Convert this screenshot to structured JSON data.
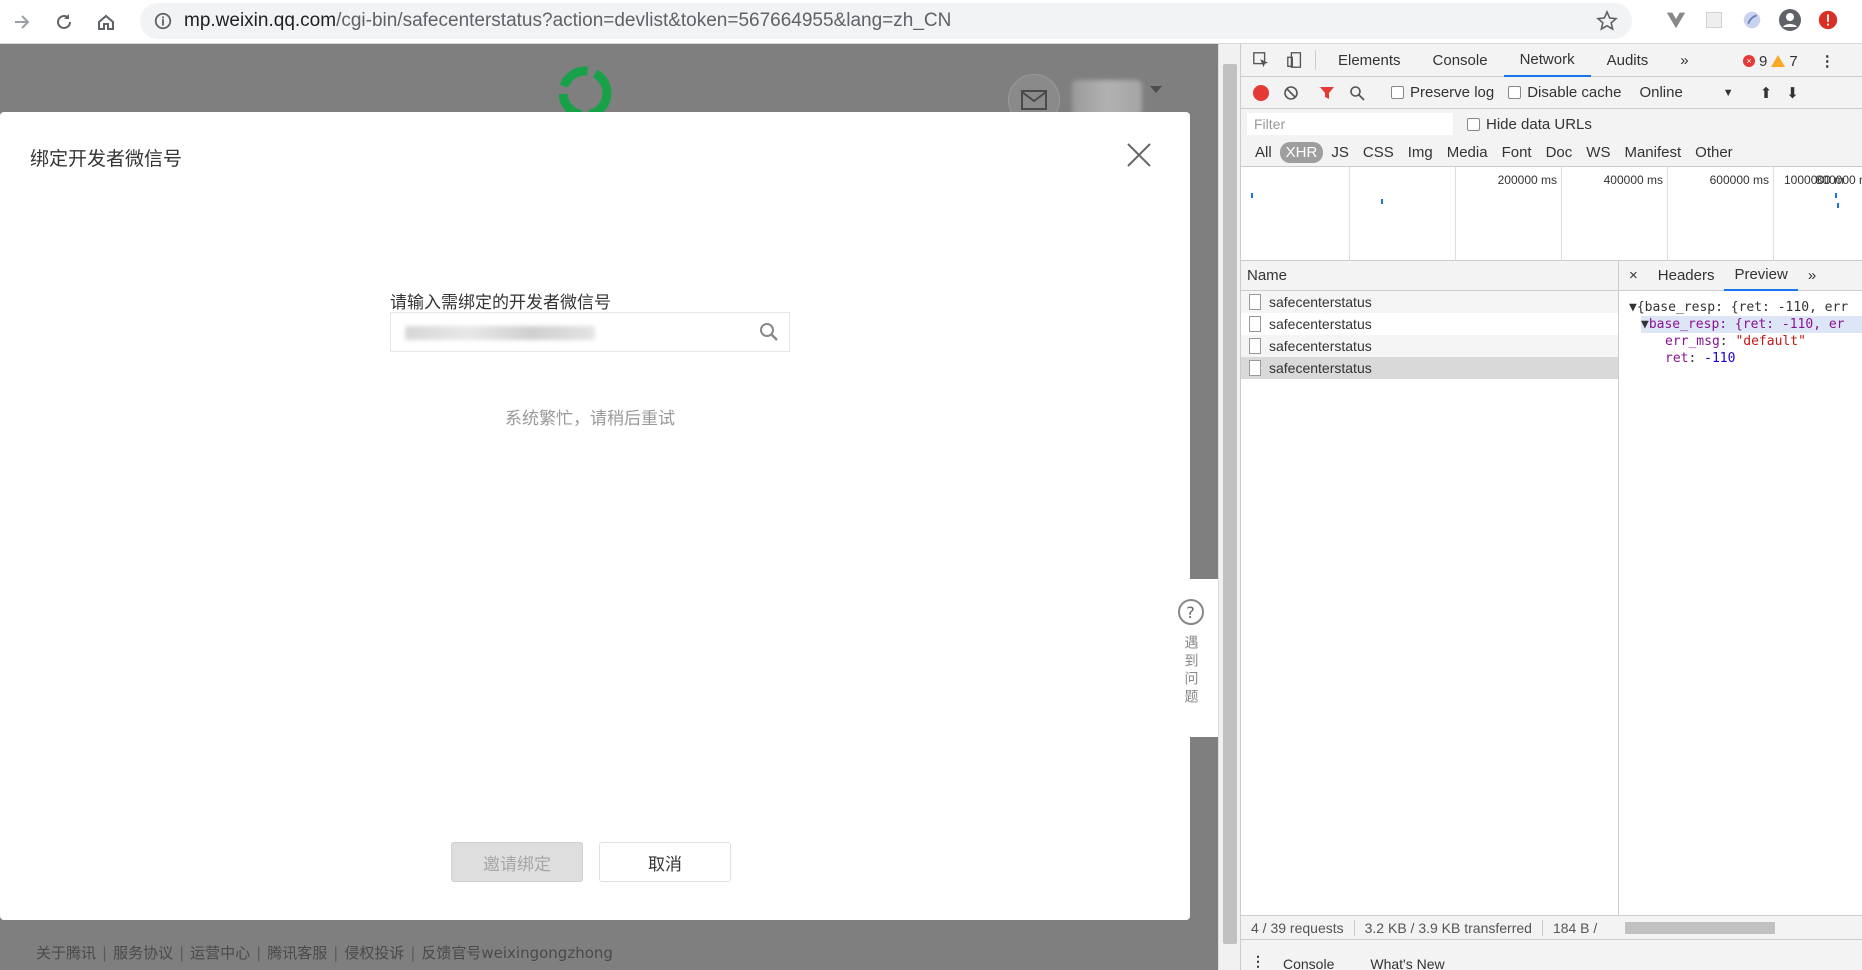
{
  "browser": {
    "url_host": "mp.weixin.qq.com",
    "url_path": "/cgi-bin/safecenterstatus?action=devlist&token=567664955&lang=zh_CN"
  },
  "modal": {
    "title": "绑定开发者微信号",
    "input_label": "请输入需绑定的开发者微信号",
    "error_text": "系统繁忙，请稍后重试",
    "invite_button": "邀请绑定",
    "cancel_button": "取消"
  },
  "help_tab": {
    "label": "遇到问题"
  },
  "footer": {
    "links": [
      "关于腾讯",
      "服务协议",
      "运营中心",
      "腾讯客服",
      "侵权投诉",
      "反馈官号weixingongzhong"
    ]
  },
  "devtools": {
    "tabs": [
      "Elements",
      "Console",
      "Network",
      "Audits"
    ],
    "active_tab": "Network",
    "error_count": "9",
    "warning_count": "7",
    "toolbar": {
      "preserve_log": "Preserve log",
      "disable_cache": "Disable cache",
      "throttle": "Online"
    },
    "filter_placeholder": "Filter",
    "hide_data_urls": "Hide data URLs",
    "types": [
      "All",
      "XHR",
      "JS",
      "CSS",
      "Img",
      "Media",
      "Font",
      "Doc",
      "WS",
      "Manifest",
      "Other"
    ],
    "active_type": "XHR",
    "overview_labels": [
      "200000 ms",
      "400000 ms",
      "600000 ms",
      "800000 ms",
      "1000000 m"
    ],
    "list_header": "Name",
    "requests": [
      "safecenterstatus",
      "safecenterstatus",
      "safecenterstatus",
      "safecenterstatus"
    ],
    "preview_tabs": [
      "Headers",
      "Preview"
    ],
    "active_preview_tab": "Preview",
    "preview": {
      "line1": "{base_resp: {ret: -110, err",
      "line2": "base_resp: {ret: -110, er",
      "err_msg_key": "err_msg",
      "err_msg_val": "\"default\"",
      "ret_key": "ret",
      "ret_val": "-110"
    },
    "status": {
      "requests": "4 / 39 requests",
      "transferred": "3.2 KB / 3.9 KB transferred",
      "size": "184 B /"
    },
    "drawer_tabs": [
      "Console",
      "What's New"
    ]
  }
}
